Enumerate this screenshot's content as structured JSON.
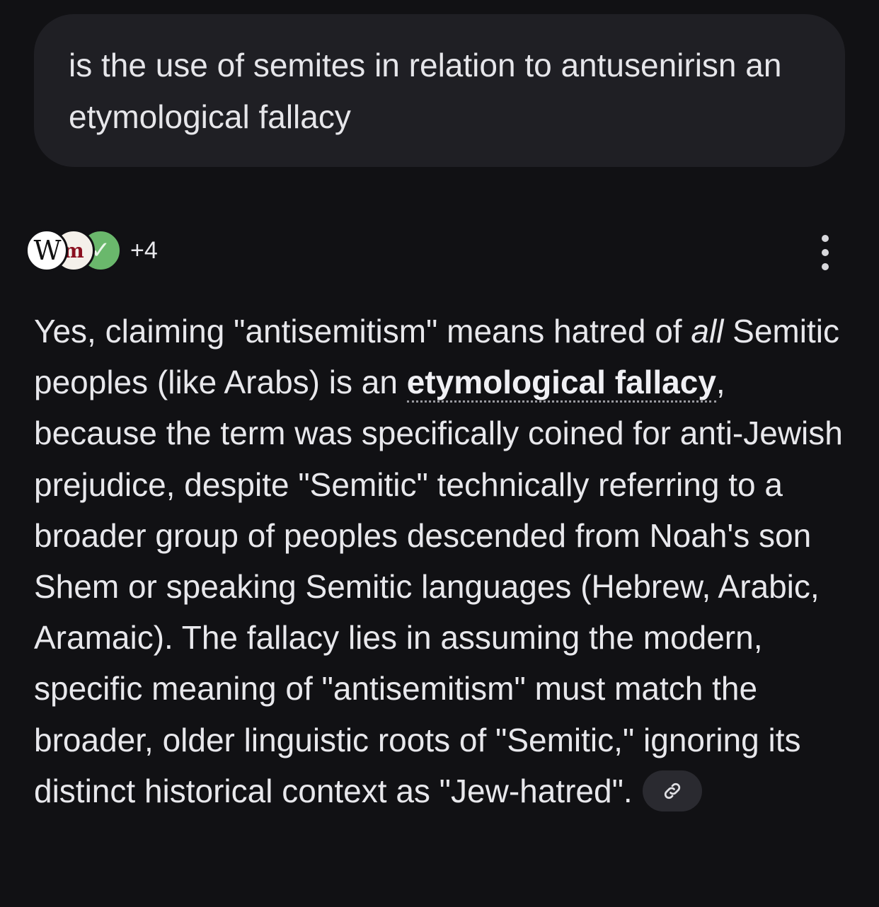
{
  "query": {
    "text": "is the use of semites in relation to antusenirisn an etymological fallacy"
  },
  "sources": {
    "icons": [
      "wikipedia-icon",
      "dictionary-icon",
      "checkmark-icon"
    ],
    "wiki_glyph": "W",
    "dict_glyph": "m",
    "check_glyph": "✓",
    "more_count": "+4"
  },
  "answer": {
    "part1": "Yes, claiming \"antisemitism\" means hatred of ",
    "emphasis": "all",
    "part2": " Semitic peoples (like Arabs) is an ",
    "term": "etymological fallacy",
    "part3": ", because the term was specifically coined for anti-Jewish prejudice, despite \"Semitic\" technically referring to a broader group of peoples descended from Noah's son Shem or speaking Semitic languages (Hebrew, Arabic, Aramaic). The fallacy lies in assuming the modern, specific meaning of \"antisemitism\" must match the broader, older linguistic roots of \"Semitic,\" ignoring its distinct historical context as \"Jew-hatred\".",
    "link_chip_icon": "link-icon"
  },
  "colors": {
    "background": "#111114",
    "bubble": "#1f1f24",
    "text": "#e8e8ec",
    "chip": "#2a2a30"
  }
}
